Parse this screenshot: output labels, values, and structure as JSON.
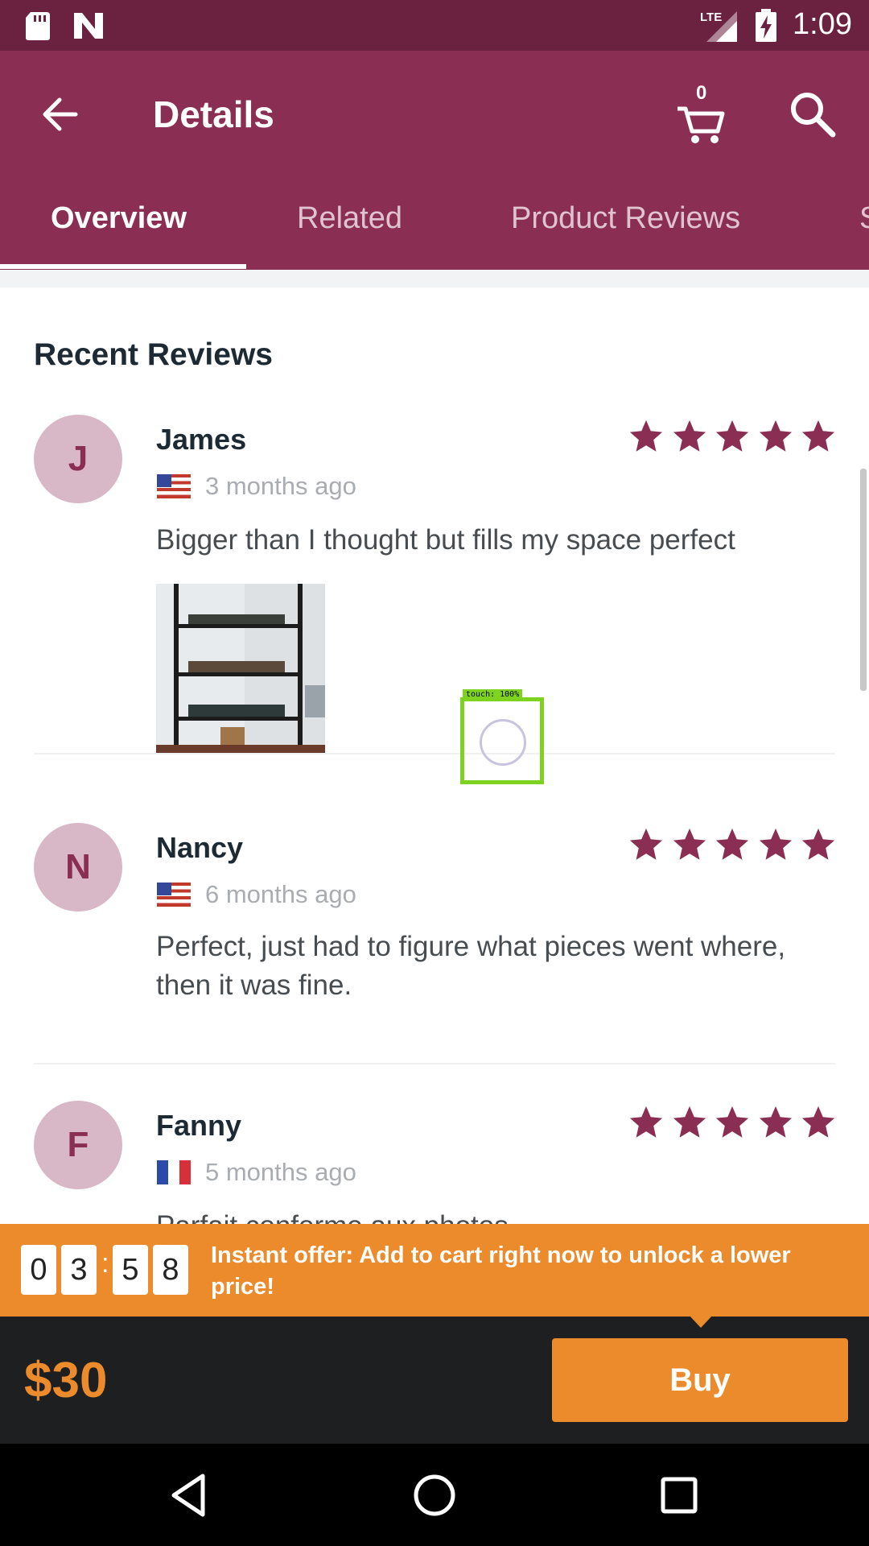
{
  "status_bar": {
    "time": "1:09",
    "network": "LTE",
    "icons": [
      "sd-card-icon",
      "n-notification-icon",
      "lte-signal-icon",
      "battery-charging-icon"
    ]
  },
  "app_bar": {
    "title": "Details",
    "cart_count": "0",
    "icons": [
      "back-arrow-icon",
      "cart-icon",
      "search-icon"
    ],
    "background_color": "#8b2e54"
  },
  "tabs": [
    {
      "label": "Overview",
      "active": true
    },
    {
      "label": "Related",
      "active": false
    },
    {
      "label": "Product Reviews",
      "active": false
    },
    {
      "label": "S",
      "active": false
    }
  ],
  "reviews_section": {
    "title": "Recent Reviews",
    "reviews": [
      {
        "initial": "J",
        "name": "James",
        "flag": "us-flag-icon",
        "time_ago": "3 months ago",
        "stars": 5,
        "text": "Bigger than I thought but fills my space perfect",
        "has_photo": true
      },
      {
        "initial": "N",
        "name": "Nancy",
        "flag": "us-flag-icon",
        "time_ago": "6 months ago",
        "stars": 5,
        "text": "Perfect, just had to figure what pieces went where, then it was fine.",
        "has_photo": false
      },
      {
        "initial": "F",
        "name": "Fanny",
        "flag": "fr-flag-icon",
        "time_ago": "5 months ago",
        "stars": 5,
        "text": "Parfait conforme aux photos",
        "has_photo": false
      }
    ]
  },
  "touch_overlay": {
    "label": "touch: 100%"
  },
  "offer_bar": {
    "countdown": [
      "0",
      "3",
      "5",
      "8"
    ],
    "separator": ":",
    "text": "Instant offer: Add to cart right now to unlock a lower price!",
    "color": "#ec8b2c"
  },
  "buy_bar": {
    "price": "$30",
    "buy_label": "Buy"
  },
  "nav_bar": {
    "icons": [
      "back-triangle-icon",
      "home-circle-icon",
      "recents-square-icon"
    ]
  },
  "colors": {
    "accent": "#8b2e54",
    "star": "#8b2e54",
    "avatar_bg": "#d8b7c6",
    "orange": "#ec8b2c"
  }
}
